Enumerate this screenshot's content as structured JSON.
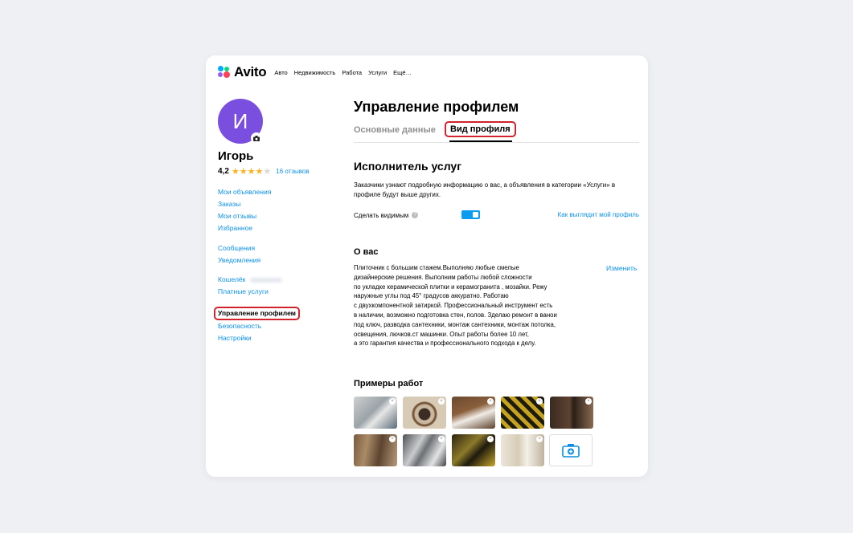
{
  "brand": {
    "name": "Avito"
  },
  "nav": [
    "Авто",
    "Недвижимость",
    "Работа",
    "Услуги",
    "Ещё…"
  ],
  "user": {
    "initial": "И",
    "name": "Игорь",
    "rating": "4,2",
    "rating_value": 4.2,
    "reviews": "16 отзывов"
  },
  "menu": {
    "group1": [
      "Мои объявления",
      "Заказы",
      "Мои отзывы",
      "Избранное"
    ],
    "group2": [
      "Сообщения",
      "Уведомления"
    ],
    "wallet": "Кошелёк",
    "paid": "Платные услуги",
    "group4": [
      "Управление профилем",
      "Безопасность",
      "Настройки"
    ],
    "active_index": 0
  },
  "page": {
    "title": "Управление профилем",
    "tabs": [
      "Основные данные",
      "Вид профиля"
    ],
    "active_tab": 1
  },
  "services": {
    "title": "Исполнитель услуг",
    "description": "Заказчики узнают подробную информацию о вас, а объявления в категории «Услуги» в профиле будут выше других.",
    "visible_label": "Сделать видимым",
    "visible_on": true,
    "preview_link": "Как выглядит мой профиль"
  },
  "about": {
    "title": "О вас",
    "edit": "Изменить",
    "lines": [
      "Плиточник с большим стажем.Выполняю любые смелые",
      "дизайнерские решения. Выполним работы любой сложности",
      "по укладке керамической плитки и керамогранита , мозайки. Режу",
      "наружные углы под 45° градусов аккуратно. Работаю",
      "с двухкомпонентной затиркой. Профессиональный инструмент есть",
      "в наличии, возможно подготовка стен, полов. Зделаю ремонт в ванои",
      "под ключ, разводка сантехники, монтаж сантехники, монтаж потолка,",
      "освещения, лючков.ст машинки. Опыт работы более 10 лет,",
      "а это гарантия качества и профессионального подхода к делу."
    ]
  },
  "works": {
    "title": "Примеры работ",
    "remove_glyph": "×"
  },
  "colors": {
    "accent": "#0a8fe0",
    "highlight": "#d0232b",
    "avatar": "#7a4fe0",
    "star": "#ffb021"
  }
}
